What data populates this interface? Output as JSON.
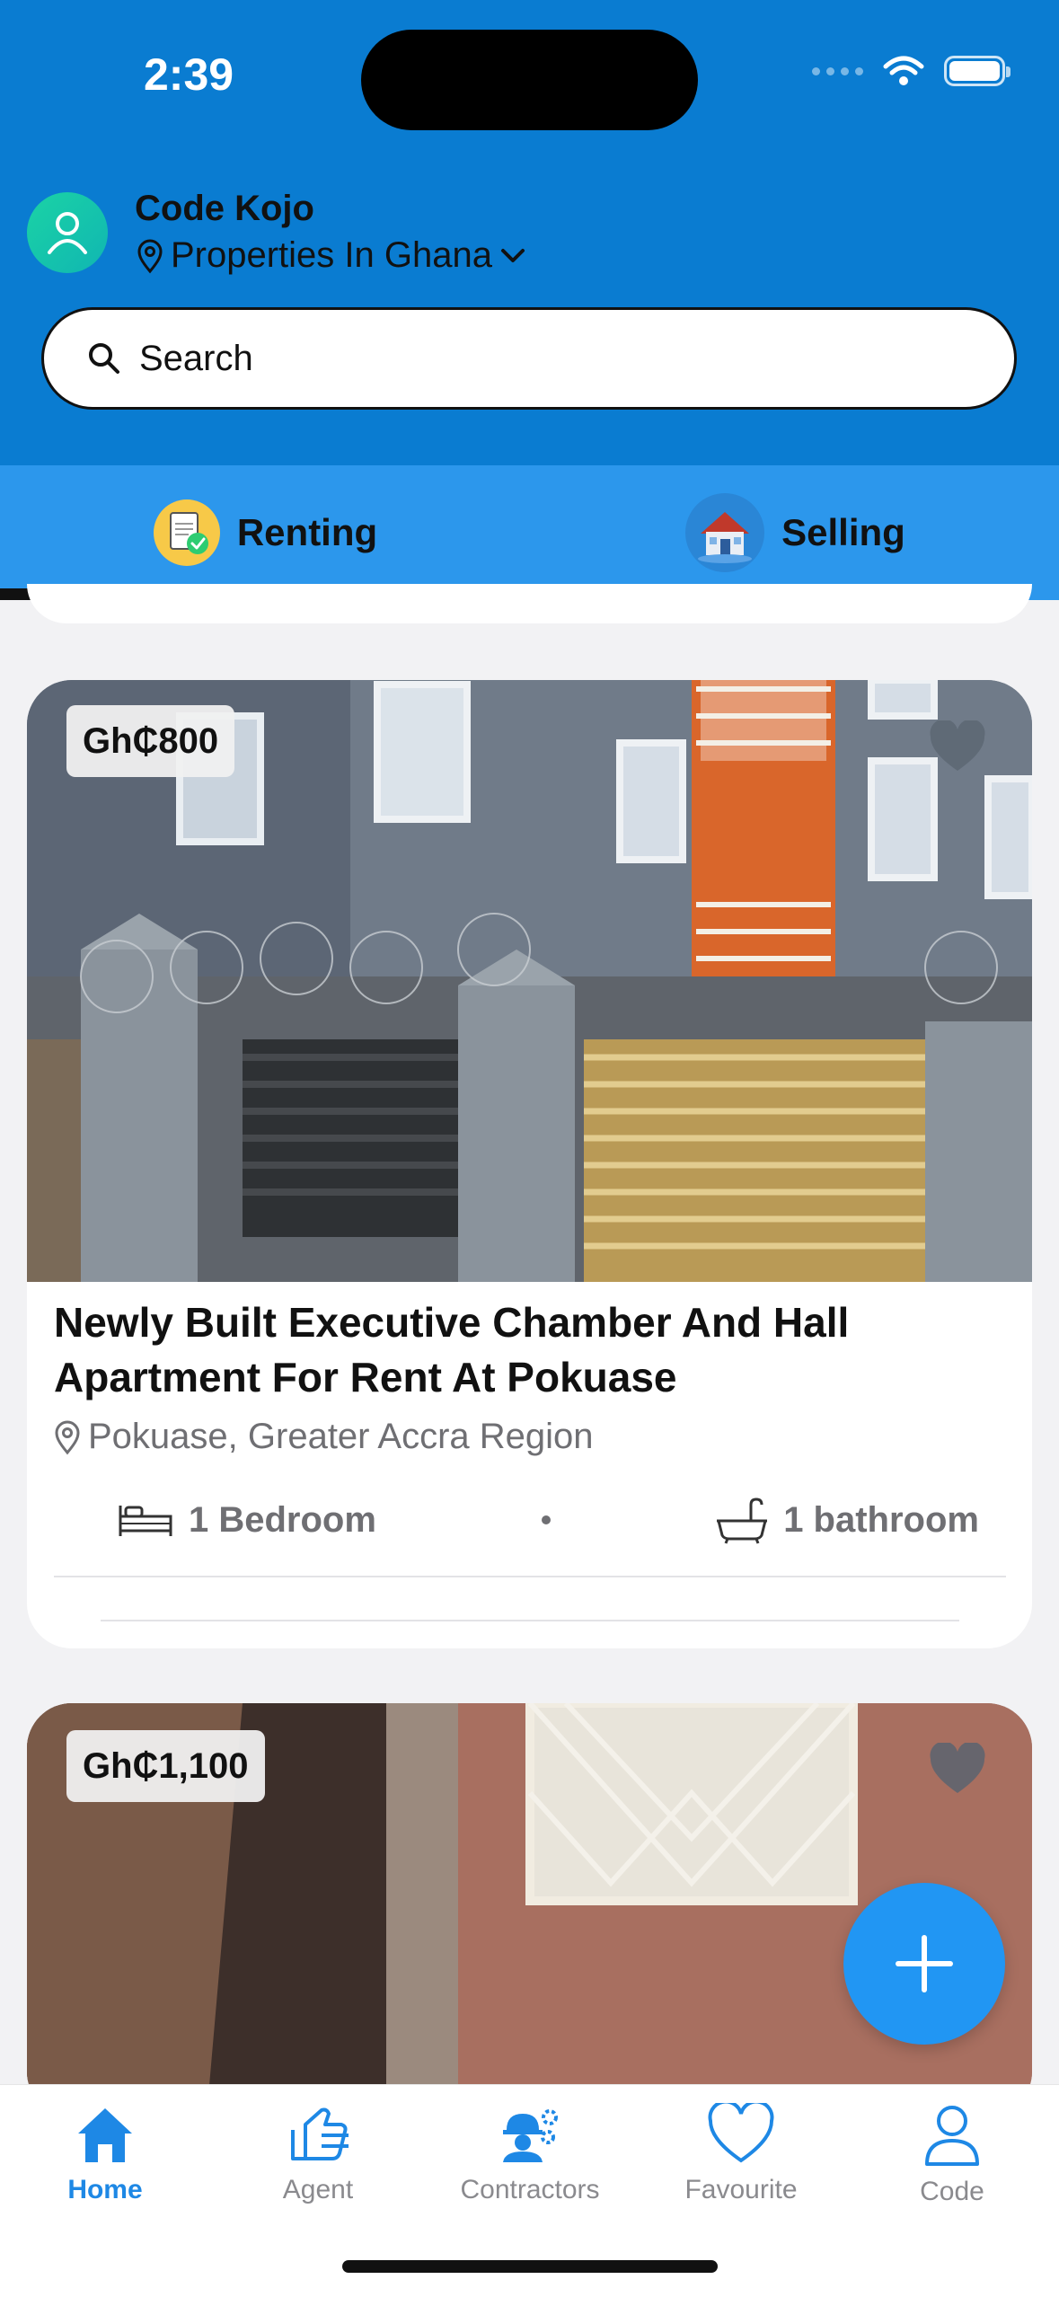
{
  "status_bar": {
    "time": "2:39"
  },
  "user": {
    "name": "Code Kojo",
    "location": "Properties In Ghana"
  },
  "search": {
    "placeholder": "Search"
  },
  "tabs": [
    {
      "label": "Renting",
      "active": true
    },
    {
      "label": "Selling",
      "active": false
    }
  ],
  "listings": [
    {
      "price": "Gh₵800",
      "title": "Newly Built Executive Chamber And Hall Apartment For Rent At Pokuase",
      "location": "Pokuase, Greater Accra Region",
      "bedrooms": "1 Bedroom",
      "bathrooms": "1 bathroom"
    },
    {
      "price": "Gh₵1,100"
    }
  ],
  "bottom_nav": [
    {
      "label": "Home",
      "icon": "home-icon",
      "active": true
    },
    {
      "label": "Agent",
      "icon": "agent-icon",
      "active": false
    },
    {
      "label": "Contractors",
      "icon": "contractors-icon",
      "active": false
    },
    {
      "label": "Favourite",
      "icon": "heart-icon",
      "active": false
    },
    {
      "label": "Code",
      "icon": "profile-icon",
      "active": false
    }
  ],
  "colors": {
    "header": "#0a7cd1",
    "tab_bar": "#2c97ec",
    "accent": "#2196f3"
  }
}
